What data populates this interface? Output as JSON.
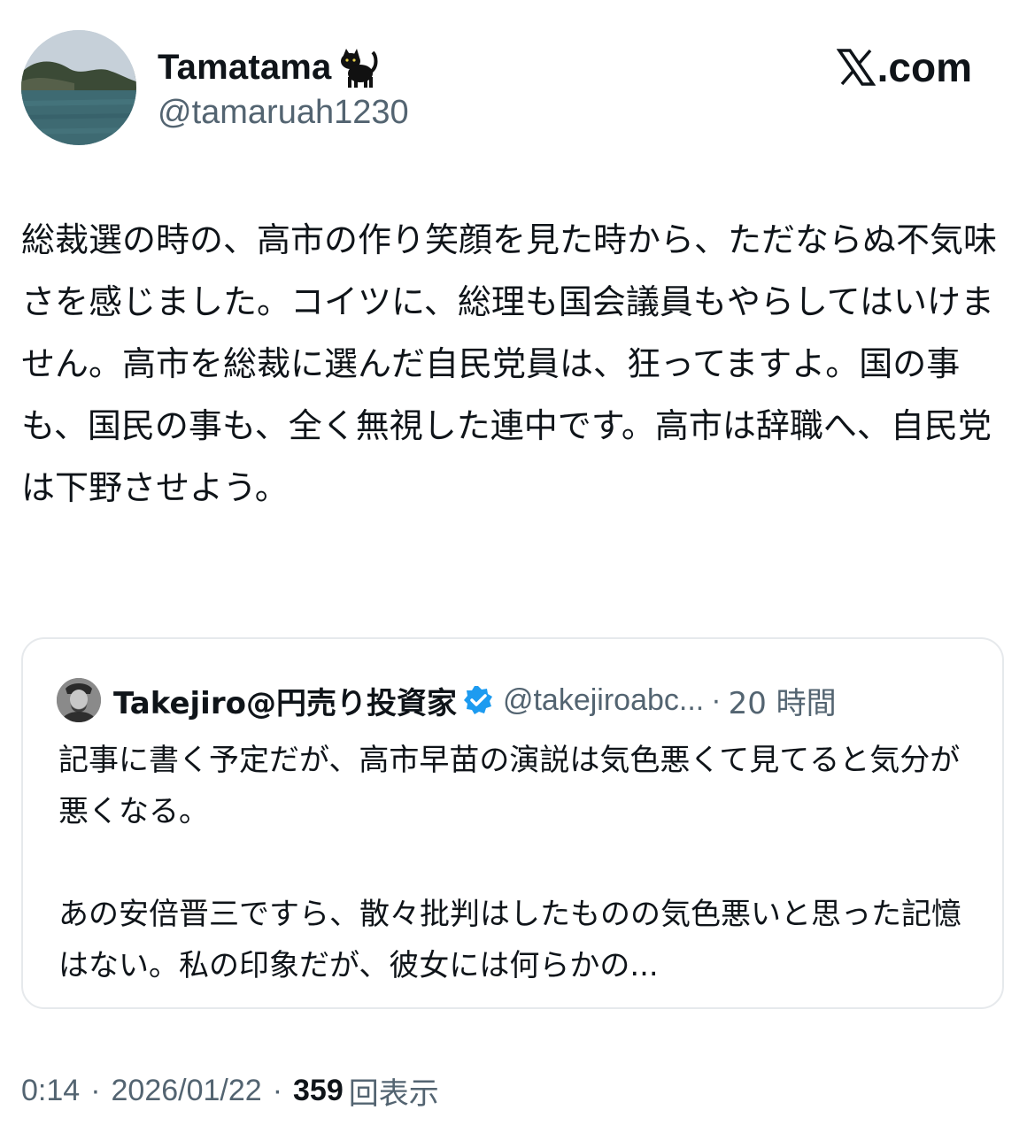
{
  "author": {
    "display_name": "Tamatama",
    "name_emoji_icon": "black-cat-icon",
    "handle": "@tamaruah1230",
    "avatar_icon": "lake-landscape-avatar"
  },
  "brand": {
    "icon": "x-logo-icon",
    "text": ".com"
  },
  "tweet": {
    "text": "総裁選の時の、高市の作り笑顔を見た時から、ただならぬ不気味さを感じました。コイツに、総理も国会議員もやらしてはいけません。高市を総裁に選んだ自民党員は、狂ってますよ。国の事も、国民の事も、全く無視した連中です。高市は辞職へ、自民党は下野させよう。"
  },
  "quoted_tweet": {
    "avatar_icon": "person-avatar",
    "display_name": "Takejiro@円売り投資家",
    "verified_icon": "verified-badge-icon",
    "handle": "@takejiroabc...",
    "separator": "·",
    "time": "20 時間",
    "text": "記事に書く予定だが、高市早苗の演説は気色悪くて見てると気分が悪くなる。\n\nあの安倍晋三ですら、散々批判はしたものの気色悪いと思った記憶はない。私の印象だが、彼女には何らかの..."
  },
  "meta": {
    "time": "0:14",
    "separator": "·",
    "date": "2026/01/22",
    "views_count": "359",
    "views_label": "回表示"
  },
  "colors": {
    "primary_text": "#0f1419",
    "secondary_text": "#536471",
    "border": "#e6e9ec",
    "verified_blue": "#1d9bf0"
  }
}
